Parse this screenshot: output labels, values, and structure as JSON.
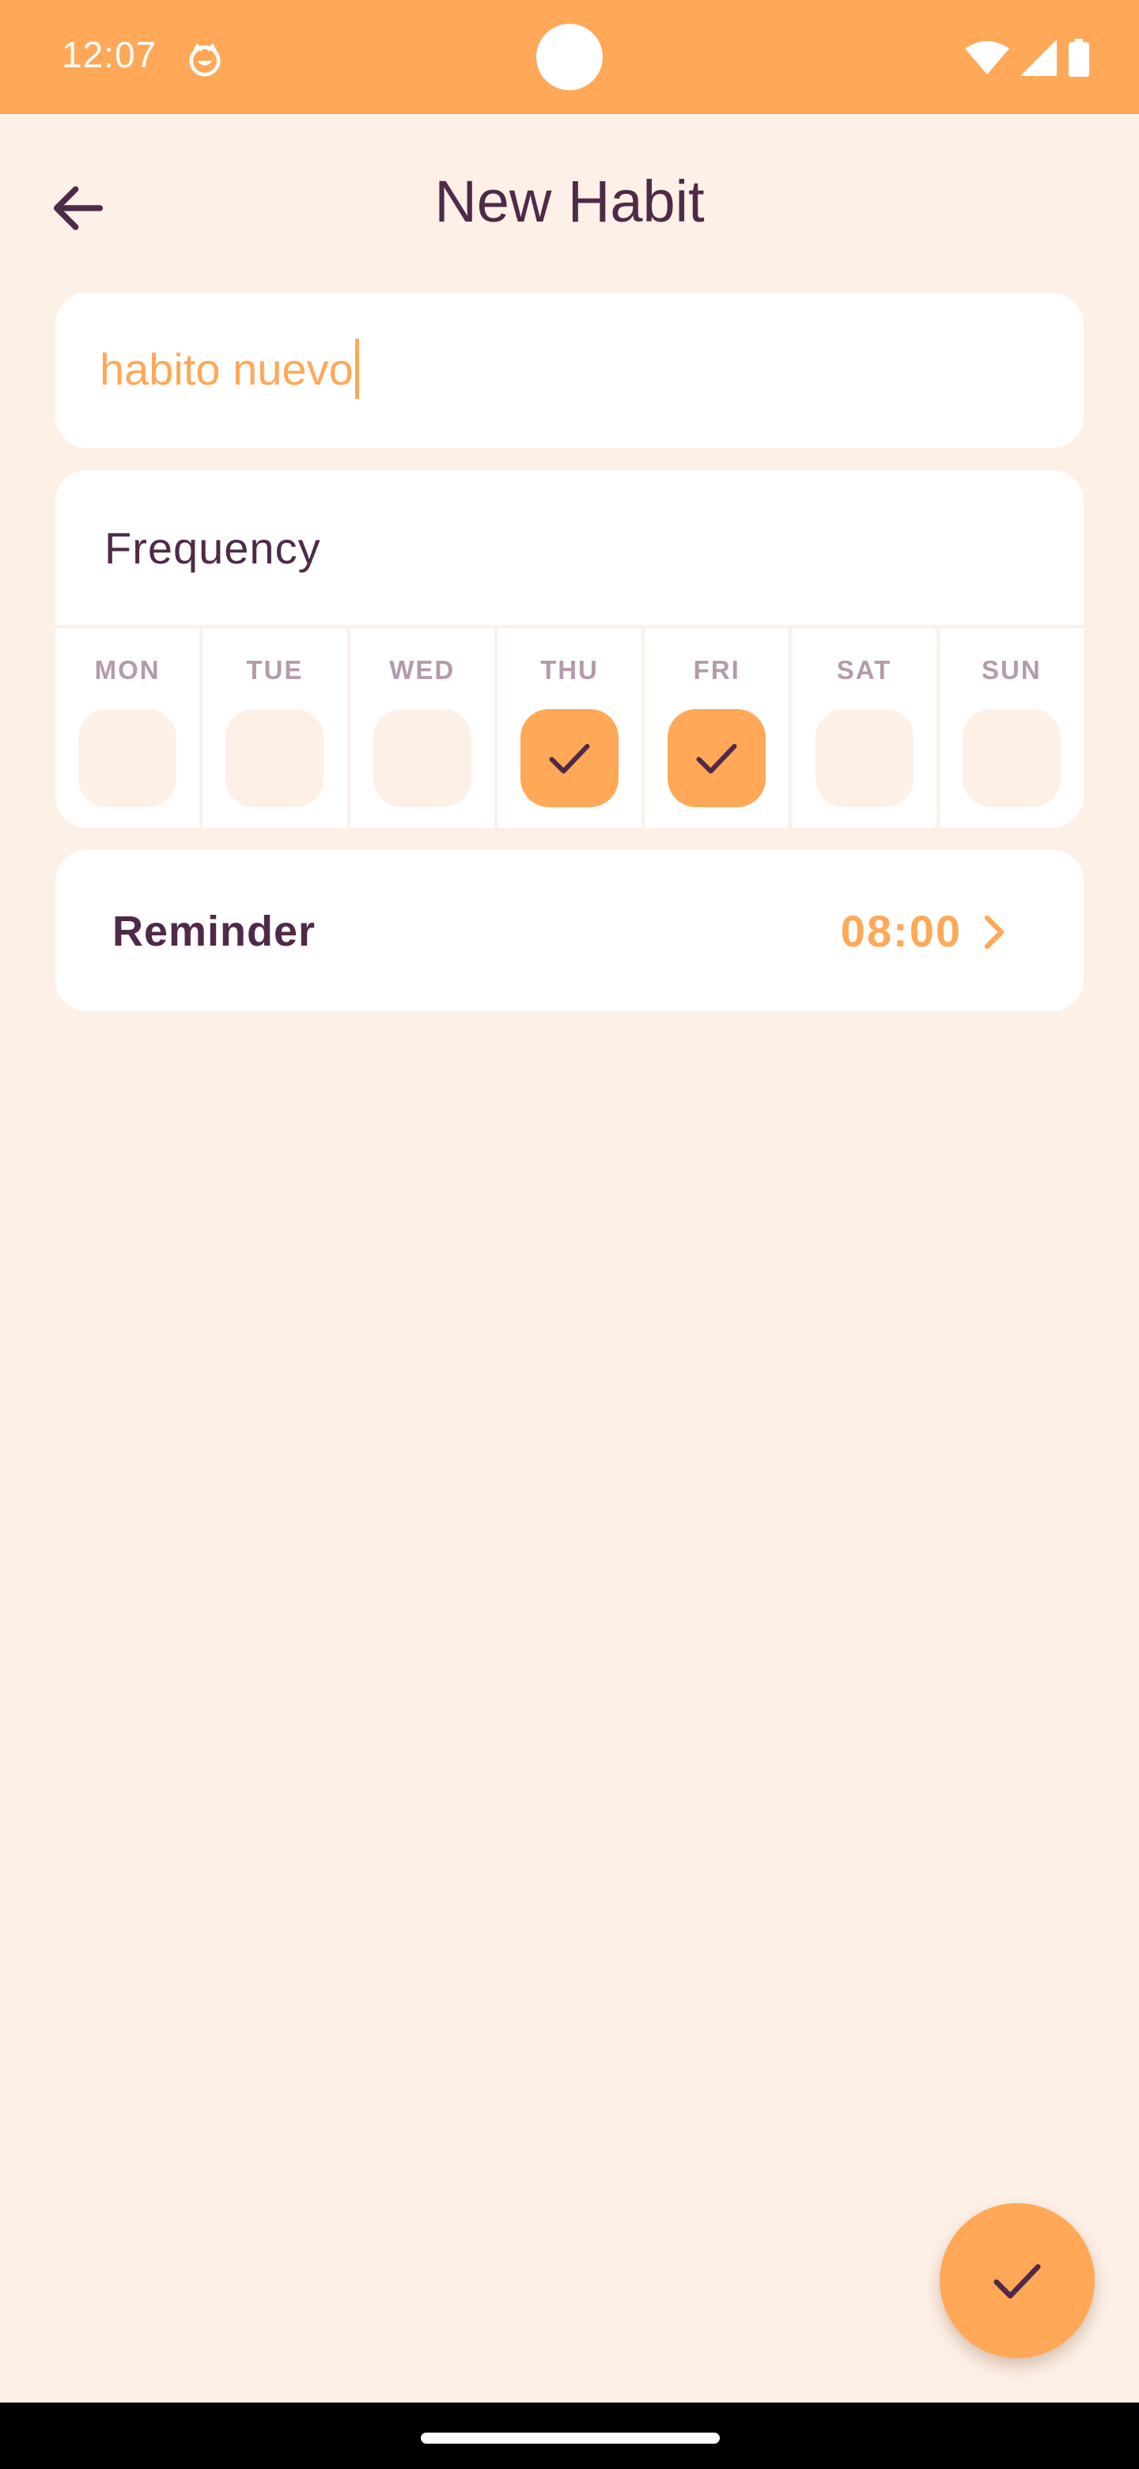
{
  "status_bar": {
    "time": "12:07",
    "icons": [
      "app-notification-icon",
      "wifi-icon",
      "cell-signal-icon",
      "battery-icon"
    ]
  },
  "header": {
    "title": "New Habit",
    "back_icon": "arrow-back-icon"
  },
  "habit_name": {
    "value": "habito nuevo"
  },
  "frequency": {
    "label": "Frequency",
    "days": [
      {
        "label": "MON",
        "checked": false
      },
      {
        "label": "TUE",
        "checked": false
      },
      {
        "label": "WED",
        "checked": false
      },
      {
        "label": "THU",
        "checked": true
      },
      {
        "label": "FRI",
        "checked": true
      },
      {
        "label": "SAT",
        "checked": false
      },
      {
        "label": "SUN",
        "checked": false
      }
    ]
  },
  "reminder": {
    "label": "Reminder",
    "time": "08:00",
    "icon": "chevron-right-icon"
  },
  "fab": {
    "icon": "check-icon"
  },
  "colors": {
    "accent": "#ffa857",
    "background": "#fdf0e7",
    "text_primary": "#4f2a48",
    "day_label": "#b49aab",
    "card": "#ffffff"
  }
}
